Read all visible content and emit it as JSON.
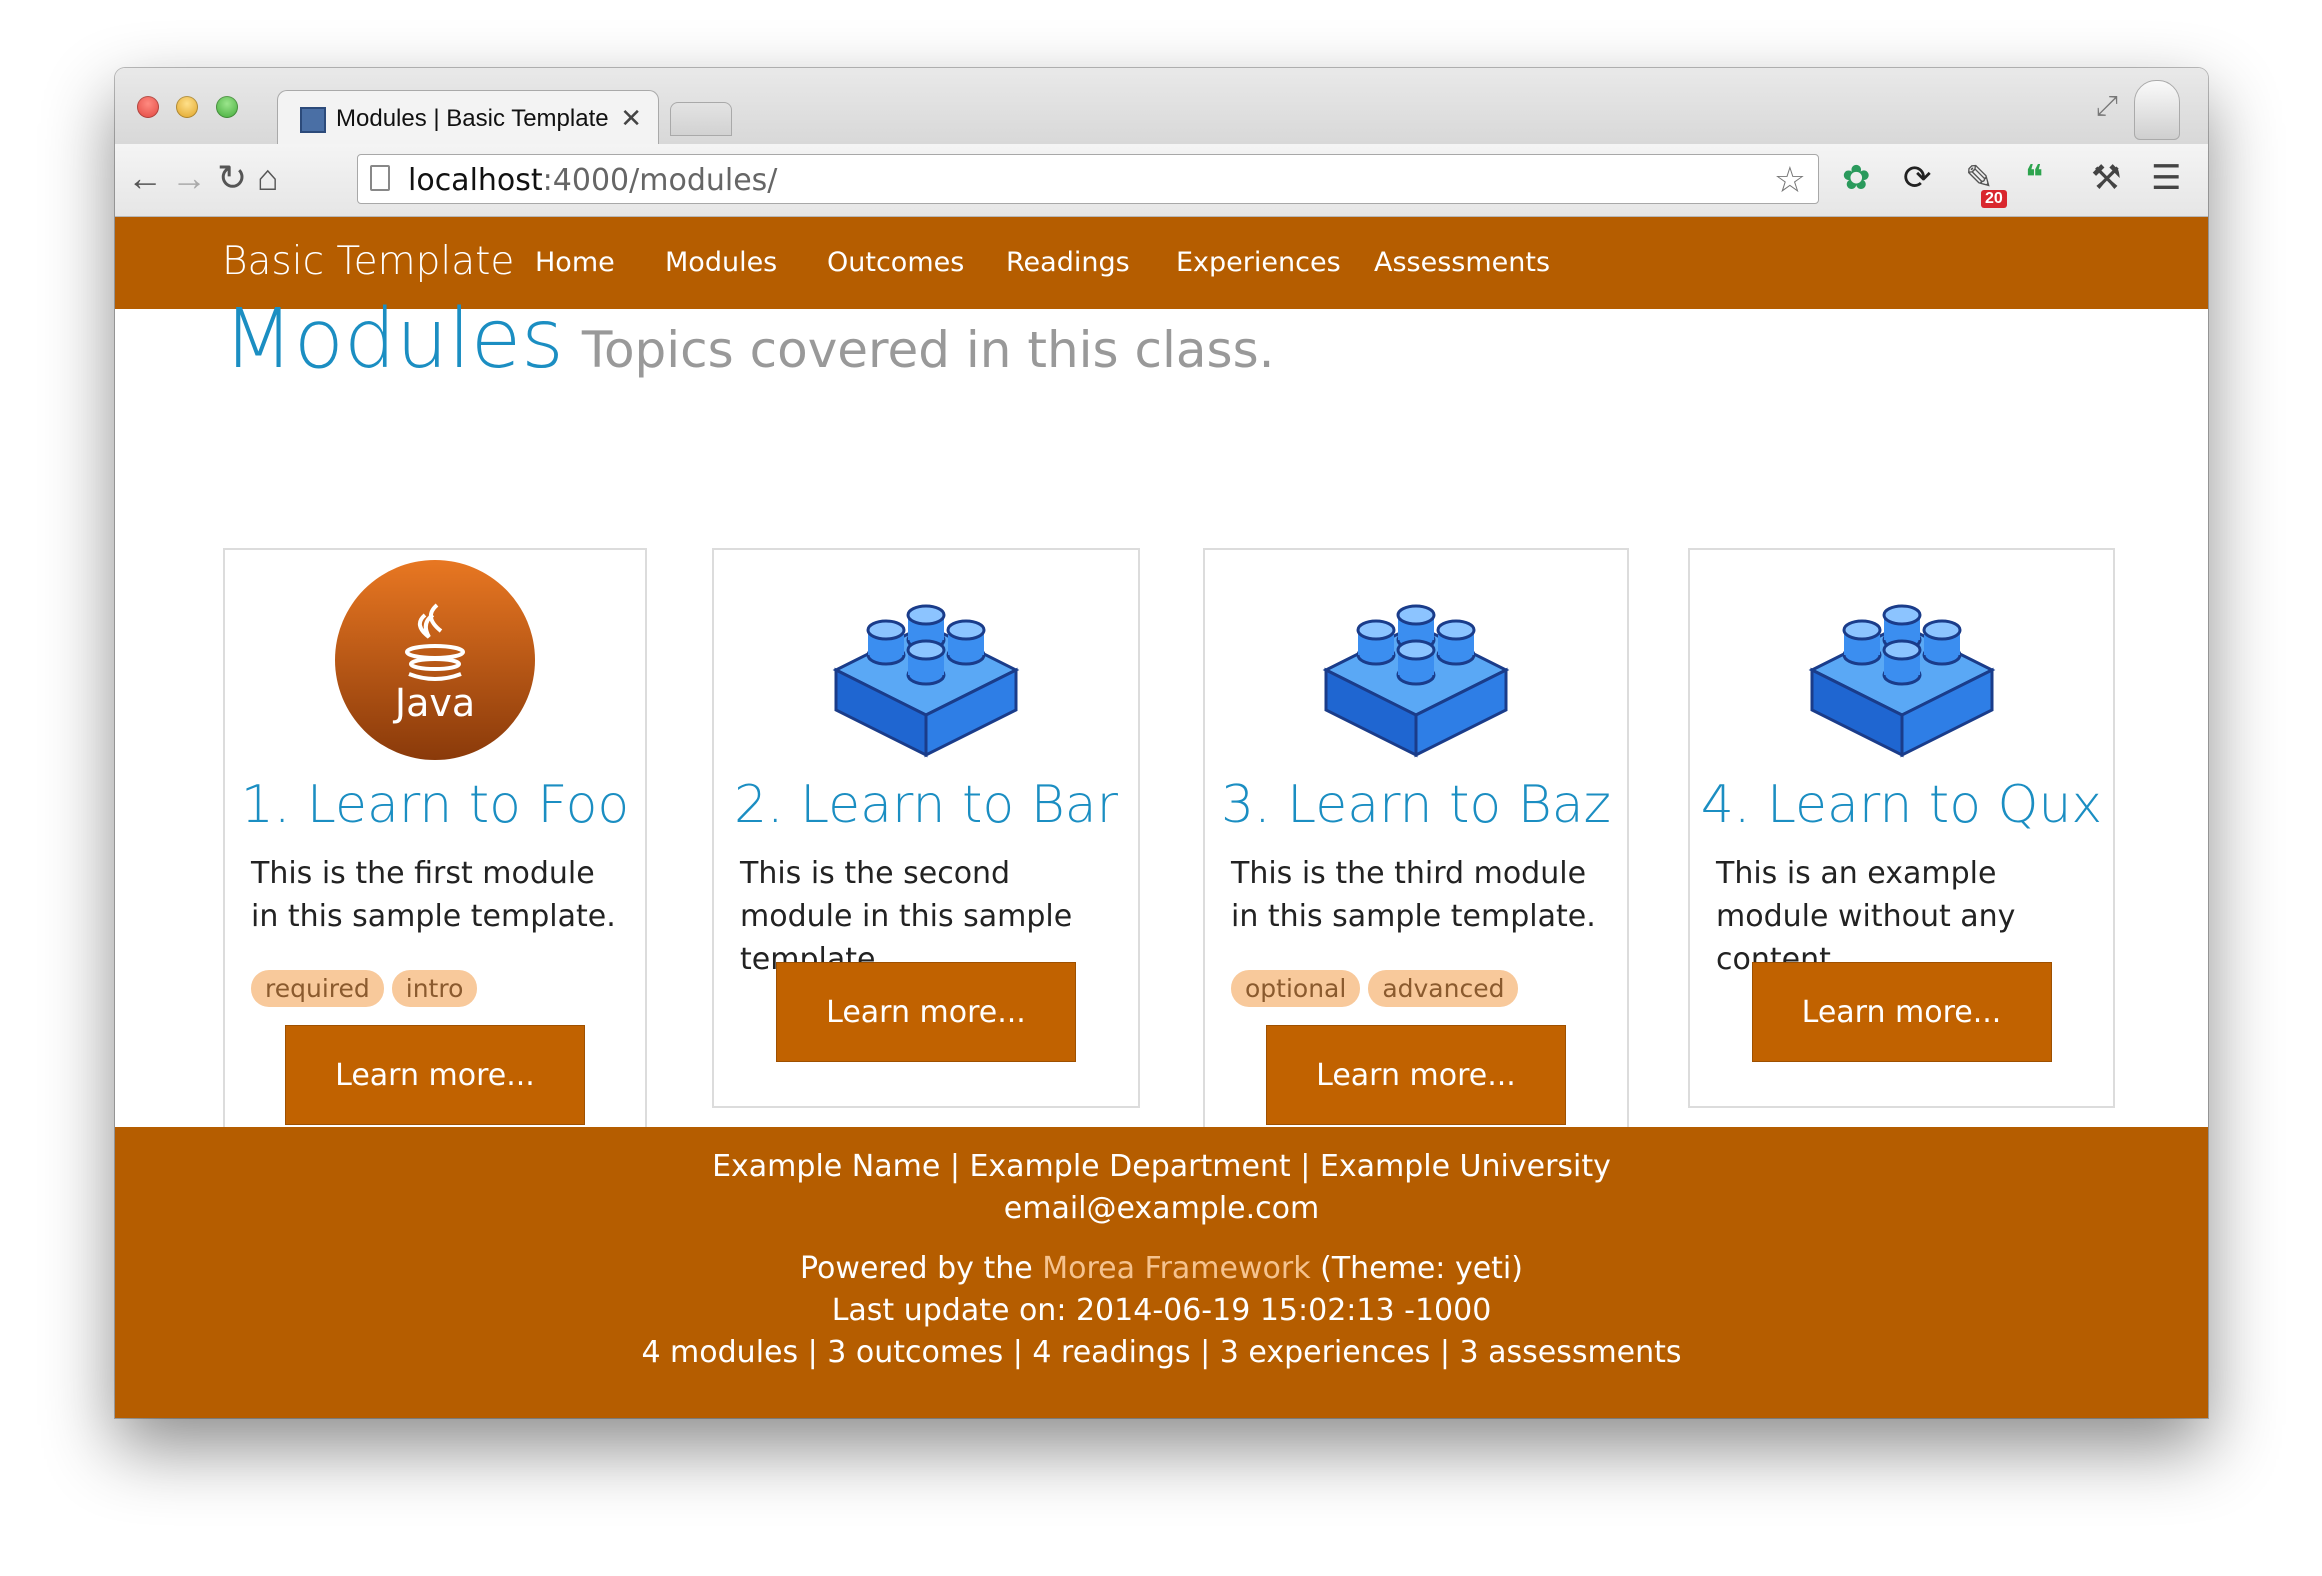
{
  "browser": {
    "tab_title": "Modules | Basic Template",
    "url_host": "localhost",
    "url_path": ":4000/modules/",
    "extension_badge": "20"
  },
  "site": {
    "brand": "Basic Template",
    "nav": [
      "Home",
      "Modules",
      "Outcomes",
      "Readings",
      "Experiences",
      "Assessments"
    ]
  },
  "page": {
    "title": "Modules",
    "subtitle": "Topics covered in this class."
  },
  "modules": [
    {
      "title": "1. Learn to Foo",
      "desc": "This is the first module in this sample template.",
      "tags": [
        "required",
        "intro"
      ],
      "button": "Learn more...",
      "icon": "java-icon",
      "icon_text": "Java"
    },
    {
      "title": "2. Learn to Bar",
      "desc": "This is the second module in this sample template.",
      "tags": [],
      "button": "Learn more...",
      "icon": "building-block-icon"
    },
    {
      "title": "3. Learn to Baz",
      "desc": "This is the third module in this sample template.",
      "tags": [
        "optional",
        "advanced"
      ],
      "button": "Learn more...",
      "icon": "building-block-icon"
    },
    {
      "title": "4. Learn to Qux",
      "desc": "This is an example module without any content.",
      "tags": [],
      "button": "Learn more...",
      "icon": "building-block-icon"
    }
  ],
  "footer": {
    "line1": "Example Name | Example Department | Example University",
    "line2": "email@example.com",
    "powered_prefix": "Powered by the ",
    "powered_link": "Morea Framework",
    "powered_suffix": " (Theme: yeti)",
    "updated": "Last update on: 2014-06-19 15:02:13 -1000",
    "counts": "4 modules | 3 outcomes | 4 readings | 3 experiences | 3 assessments"
  },
  "colors": {
    "brand_orange": "#b55d00",
    "button_orange": "#c16200",
    "heading_blue": "#1b8ec2",
    "tag_bg": "#f8c99b"
  }
}
